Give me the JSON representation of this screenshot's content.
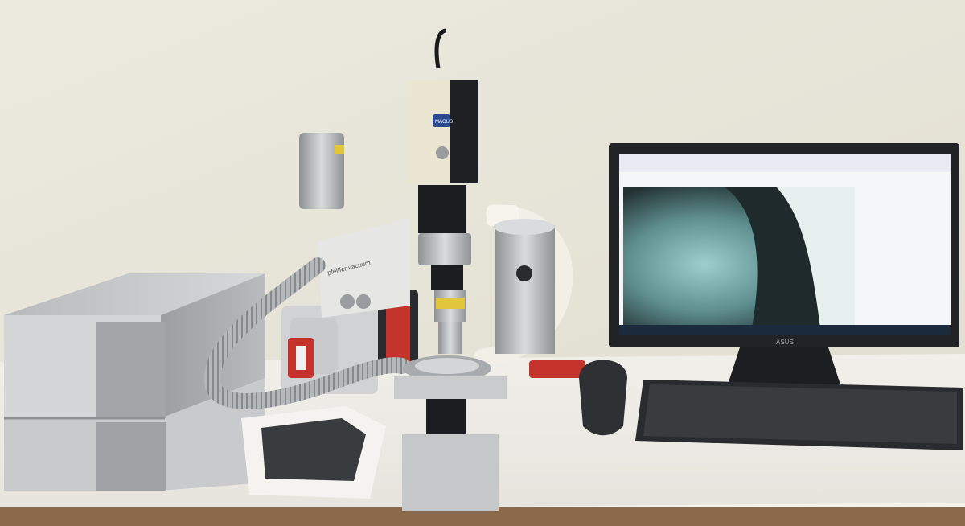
{
  "scene": {
    "kind": "laboratory microscope setup",
    "colors": {
      "wall": "#e9e6da",
      "desk": "#f3f2ee",
      "floor": "#8a6a4a",
      "chassis": "#c4c6c8",
      "monitor_frame": "#222326",
      "screen_view": "#2b3d3f",
      "hose": "#b9bcbe",
      "white_hose": "#f1efe6",
      "red_accent": "#c3322b"
    }
  },
  "monitor": {
    "brand": "ASUS",
    "screen_corner_text": "ASUS"
  },
  "camera": {
    "brand_badge": "MAGUS"
  },
  "pump": {
    "brand": "pfeiffer vacuum"
  }
}
